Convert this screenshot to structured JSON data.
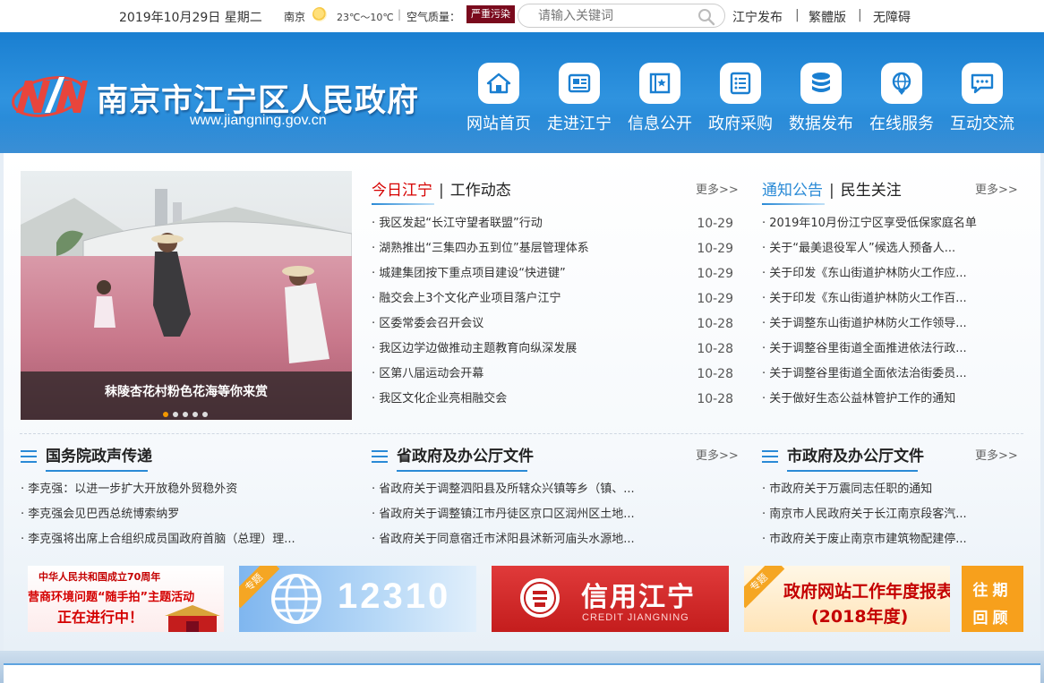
{
  "topbar": {
    "date": "2019年10月29日 星期二",
    "city": "南京",
    "weather_icon": "sun-cloud-icon",
    "temperature": "23℃～10℃",
    "air_quality_label": "空气质量：",
    "air_quality_value": "严重污染",
    "search_placeholder": "请输入关键词",
    "links": [
      "江宁发布",
      "繁體版",
      "无障碍"
    ],
    "separator": "|"
  },
  "header": {
    "site_name": "南京市江宁区人民政府",
    "site_url": "www.jiangning.gov.cn",
    "nav": [
      {
        "label": "网站首页",
        "icon": "home-icon"
      },
      {
        "label": "走进江宁",
        "icon": "newspaper-icon"
      },
      {
        "label": "信息公开",
        "icon": "book-icon"
      },
      {
        "label": "政府采购",
        "icon": "list-icon"
      },
      {
        "label": "数据发布",
        "icon": "database-icon"
      },
      {
        "label": "在线服务",
        "icon": "globe-pin-icon"
      },
      {
        "label": "互动交流",
        "icon": "chat-icon"
      }
    ]
  },
  "slider": {
    "caption": "秣陵杏花村粉色花海等你来赏",
    "dots": 5,
    "active_dot": 0
  },
  "news": {
    "tab_active": "今日江宁",
    "tab_other": "工作动态",
    "tab_sep": "|",
    "more": "更多>>",
    "items": [
      {
        "title": "· 我区发起“长江守望者联盟”行动",
        "date": "10-29"
      },
      {
        "title": "· 湖熟推出“三集四办五到位”基层管理体系",
        "date": "10-29"
      },
      {
        "title": "· 城建集团按下重点项目建设“快进键”",
        "date": "10-29"
      },
      {
        "title": "· 融交会上3个文化产业项目落户江宁",
        "date": "10-29"
      },
      {
        "title": "· 区委常委会召开会议",
        "date": "10-28"
      },
      {
        "title": "· 我区边学边做推动主题教育向纵深发展",
        "date": "10-28"
      },
      {
        "title": "· 区第八届运动会开幕",
        "date": "10-28"
      },
      {
        "title": "· 我区文化企业亮相融交会",
        "date": "10-28"
      }
    ]
  },
  "notice": {
    "tab_active": "通知公告",
    "tab_other": "民生关注",
    "tab_sep": "|",
    "more": "更多>>",
    "items": [
      "· 2019年10月份江宁区享受低保家庭名单",
      "· 关于“最美退役军人”候选人预备人...",
      "· 关于印发《东山街道护林防火工作应...",
      "· 关于印发《东山街道护林防火工作百...",
      "· 关于调整东山街道护林防火工作领导...",
      "· 关于调整谷里街道全面推进依法行政...",
      "· 关于调整谷里街道全面依法治街委员...",
      "· 关于做好生态公益林管护工作的通知"
    ]
  },
  "sections": [
    {
      "title": "国务院政声传递",
      "more": "",
      "items": [
        "· 李克强：以进一步扩大开放稳外贸稳外资",
        "· 李克强会见巴西总统博索纳罗",
        "· 李克强将出席上合组织成员国政府首脑（总理）理..."
      ]
    },
    {
      "title": "省政府及办公厅文件",
      "more": "更多>>",
      "items": [
        "· 省政府关于调整泗阳县及所辖众兴镇等乡（镇、...",
        "· 省政府关于调整镇江市丹徒区京口区润州区土地...",
        "· 省政府关于同意宿迁市沭阳县沭新河庙头水源地..."
      ]
    },
    {
      "title": "市政府及办公厅文件",
      "more": "更多>>",
      "items": [
        "· 市政府关于万震同志任职的通知",
        "· 南京市人民政府关于长江南京段客汽...",
        "· 市政府关于废止南京市建筑物配建停..."
      ]
    }
  ],
  "banners": {
    "b1_line1": "中华人民共和国成立70周年",
    "b1_line2": "营商环境问题“随手拍”主题活动",
    "b1_line3": "正在进行中！",
    "ribbon": "专题",
    "b2_number": "12310",
    "b3_cn": "信用江宁",
    "b3_en": "CREDIT JIANGNING",
    "b4_line1": "政府网站工作年度报表",
    "b4_line2": "(2018年度)",
    "b5_line1": "往期",
    "b5_line2": "回顾"
  },
  "colors": {
    "header_blue": "#1f86d6",
    "accent_red": "#d60000",
    "accent_blue": "#2a8ad6",
    "aq_badge": "#7a0a1d",
    "orange": "#f7a01c"
  }
}
